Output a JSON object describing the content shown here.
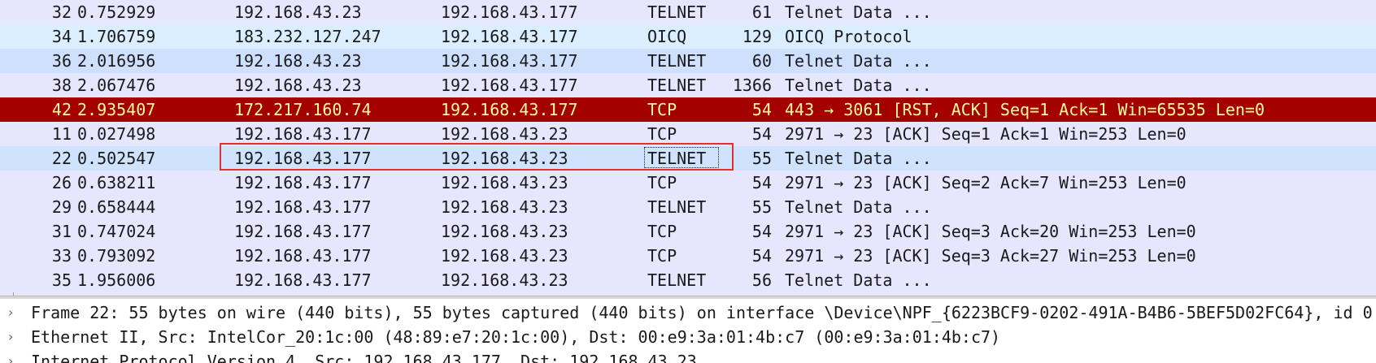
{
  "packet_list": {
    "rows": [
      {
        "no": "32",
        "time": "0.752929",
        "source": "192.168.43.23",
        "destination": "192.168.43.177",
        "protocol": "TELNET",
        "length": "61",
        "info": "Telnet Data ..."
      },
      {
        "no": "34",
        "time": "1.706759",
        "source": "183.232.127.247",
        "destination": "192.168.43.177",
        "protocol": "OICQ",
        "length": "129",
        "info": "OICQ Protocol"
      },
      {
        "no": "36",
        "time": "2.016956",
        "source": "192.168.43.23",
        "destination": "192.168.43.177",
        "protocol": "TELNET",
        "length": "60",
        "info": "Telnet Data ..."
      },
      {
        "no": "38",
        "time": "2.067476",
        "source": "192.168.43.23",
        "destination": "192.168.43.177",
        "protocol": "TELNET",
        "length": "1366",
        "info": "Telnet Data ..."
      },
      {
        "no": "42",
        "time": "2.935407",
        "source": "172.217.160.74",
        "destination": "192.168.43.177",
        "protocol": "TCP",
        "length": "54",
        "info": "443 → 3061 [RST, ACK] Seq=1 Ack=1 Win=65535 Len=0"
      },
      {
        "no": "11",
        "time": "0.027498",
        "source": "192.168.43.177",
        "destination": "192.168.43.23",
        "protocol": "TCP",
        "length": "54",
        "info": "2971 → 23 [ACK] Seq=1 Ack=1 Win=253 Len=0"
      },
      {
        "no": "22",
        "time": "0.502547",
        "source": "192.168.43.177",
        "destination": "192.168.43.23",
        "protocol": "TELNET",
        "length": "55",
        "info": "Telnet Data ..."
      },
      {
        "no": "26",
        "time": "0.638211",
        "source": "192.168.43.177",
        "destination": "192.168.43.23",
        "protocol": "TCP",
        "length": "54",
        "info": "2971 → 23 [ACK] Seq=2 Ack=7 Win=253 Len=0"
      },
      {
        "no": "29",
        "time": "0.658444",
        "source": "192.168.43.177",
        "destination": "192.168.43.23",
        "protocol": "TELNET",
        "length": "55",
        "info": "Telnet Data ..."
      },
      {
        "no": "31",
        "time": "0.747024",
        "source": "192.168.43.177",
        "destination": "192.168.43.23",
        "protocol": "TCP",
        "length": "54",
        "info": "2971 → 23 [ACK] Seq=3 Ack=20 Win=253 Len=0"
      },
      {
        "no": "33",
        "time": "0.793092",
        "source": "192.168.43.177",
        "destination": "192.168.43.23",
        "protocol": "TCP",
        "length": "54",
        "info": "2971 → 23 [ACK] Seq=3 Ack=27 Win=253 Len=0"
      },
      {
        "no": "35",
        "time": "1.956006",
        "source": "192.168.43.177",
        "destination": "192.168.43.23",
        "protocol": "TELNET",
        "length": "56",
        "info": "Telnet Data ..."
      }
    ]
  },
  "details": {
    "rows": [
      {
        "chevron": "›",
        "text": "Frame 22: 55 bytes on wire (440 bits), 55 bytes captured (440 bits) on interface \\Device\\NPF_{6223BCF9-0202-491A-B4B6-5BEF5D02FC64}, id 0"
      },
      {
        "chevron": "›",
        "text": "Ethernet II, Src: IntelCor_20:1c:00 (48:89:e7:20:1c:00), Dst: 00:e9:3a:01:4b:c7 (00:e9:3a:01:4b:c7)"
      },
      {
        "chevron": "›",
        "text": "Internet Protocol Version 4, Src: 192.168.43.177, Dst: 192.168.43.23"
      }
    ]
  },
  "colors": {
    "row_telnet": "#e7e6ff",
    "row_oicq": "#daeeff",
    "row_rst_bg": "#a40000",
    "row_rst_fg": "#fffc9c",
    "row_selected": "#cfe3ff",
    "highlight_border": "#e0312d"
  }
}
